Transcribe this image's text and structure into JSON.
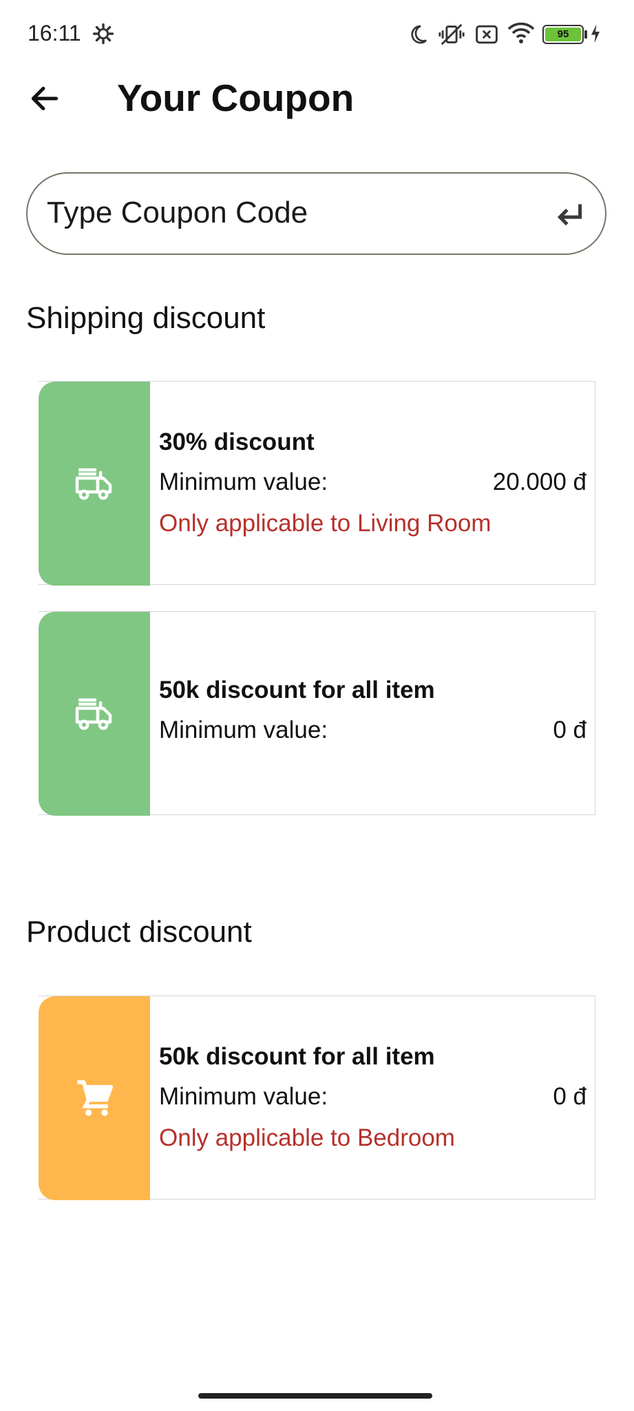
{
  "status_bar": {
    "time": "16:11",
    "battery": "95",
    "icons": [
      "settings-gear-icon",
      "moon-icon",
      "vibrate-off-icon",
      "sim-off-icon",
      "wifi-icon",
      "battery-icon",
      "charging-bolt-icon"
    ]
  },
  "app_bar": {
    "title": "Your Coupon",
    "back_icon": "arrow-left-icon"
  },
  "coupon_input": {
    "placeholder": "Type Coupon Code",
    "action_icon": "enter-return-icon"
  },
  "sections": {
    "shipping": {
      "title": "Shipping discount",
      "accent": "#81c784",
      "icon": "fire-truck-icon",
      "coupons": [
        {
          "name": "30% discount",
          "min_label": "Minimum value:",
          "min_value": "20.000 đ",
          "note": "Only applicable to Living Room"
        },
        {
          "name": "50k discount for all item",
          "min_label": "Minimum value:",
          "min_value": "0 đ",
          "note": ""
        }
      ]
    },
    "product": {
      "title": "Product discount",
      "accent": "#ffb74d",
      "icon": "shopping-cart-icon",
      "coupons": [
        {
          "name": "50k discount for all item",
          "min_label": "Minimum value:",
          "min_value": "0 đ",
          "note": "Only applicable to Bedroom"
        }
      ]
    }
  },
  "colors": {
    "note_red": "#b6312b",
    "shipping_green": "#81c784",
    "product_orange": "#ffb74d"
  }
}
